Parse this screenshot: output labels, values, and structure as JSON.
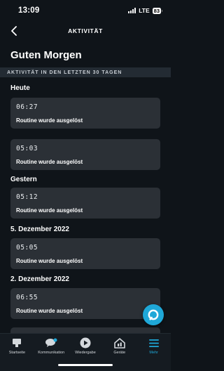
{
  "status_bar": {
    "time": "13:09",
    "network": "LTE",
    "battery": "83"
  },
  "nav": {
    "title": "AKTIVITÄT"
  },
  "greeting": "Guten Morgen",
  "section_header": "AKTIVITÄT IN DEN LETZTEN 30 TAGEN",
  "groups": [
    {
      "label": "Heute",
      "items": [
        {
          "time": "06:27",
          "text": "Routine wurde ausgelöst"
        },
        {
          "time": "05:03",
          "text": "Routine wurde ausgelöst"
        }
      ]
    },
    {
      "label": "Gestern",
      "items": [
        {
          "time": "05:12",
          "text": "Routine wurde ausgelöst"
        }
      ]
    },
    {
      "label": "5. Dezember 2022",
      "items": [
        {
          "time": "05:05",
          "text": "Routine wurde ausgelöst"
        }
      ]
    },
    {
      "label": "2. Dezember 2022",
      "items": [
        {
          "time": "06:55",
          "text": "Routine wurde ausgelöst"
        }
      ]
    }
  ],
  "tabbar": {
    "items": [
      {
        "label": "Startseite",
        "icon": "home-icon"
      },
      {
        "label": "Kommunikation",
        "icon": "chat-icon"
      },
      {
        "label": "Wiedergabe",
        "icon": "play-icon"
      },
      {
        "label": "Geräte",
        "icon": "devices-icon"
      },
      {
        "label": "Mehr",
        "icon": "menu-icon"
      }
    ],
    "active": "Mehr"
  },
  "colors": {
    "accent": "#1fa8d8",
    "background": "#0f1419",
    "card": "#2b3036"
  }
}
